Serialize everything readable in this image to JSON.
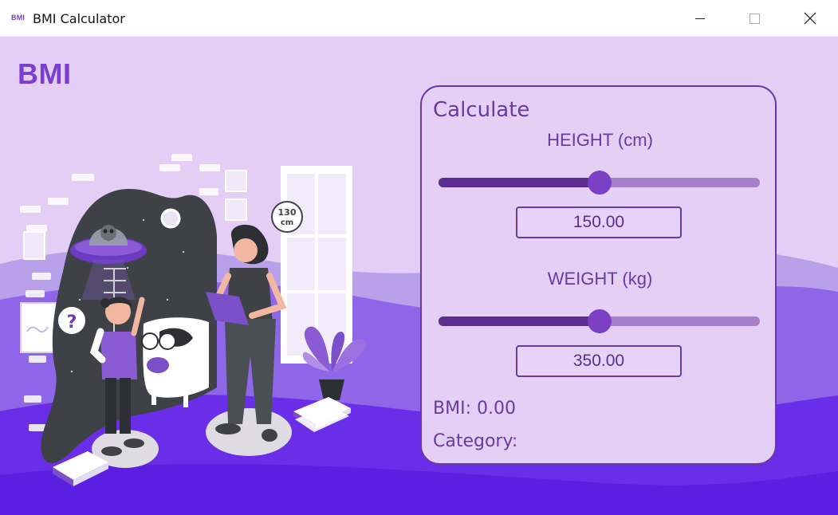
{
  "window": {
    "icon_text": "BMI",
    "title": "BMI Calculator"
  },
  "app": {
    "logo": "BMI"
  },
  "illustration": {
    "height_badge_number": "130",
    "height_badge_unit": "cm",
    "question_mark": "?"
  },
  "card": {
    "title": "Calculate",
    "height_label": "HEIGHT (cm)",
    "height_value": "150.00",
    "height_slider_fraction": 0.5,
    "weight_label": "WEIGHT (kg)",
    "weight_value": "350.00",
    "weight_slider_fraction": 0.5,
    "bmi_text": "BMI: 0.00",
    "category_text": "Category:"
  },
  "colors": {
    "accent": "#7a3fd0",
    "card_border": "#6b38a8",
    "background": "#e4cef5",
    "wave_dark": "#6a2ee8"
  }
}
